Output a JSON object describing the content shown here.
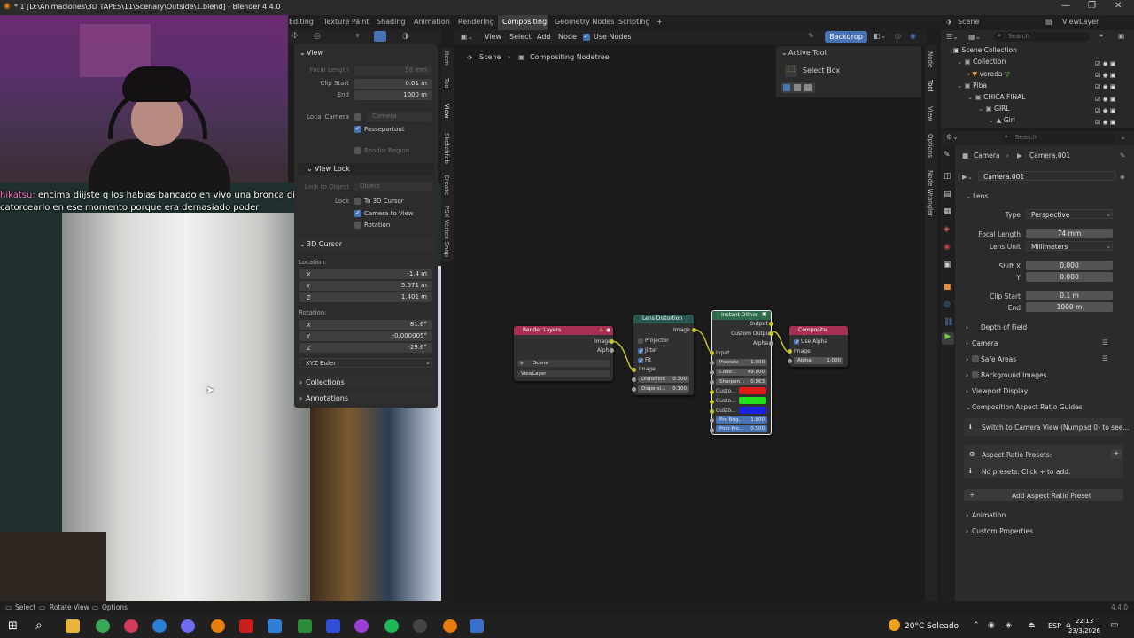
{
  "window": {
    "title": "* 1 [D:\\Animaciones\\3D TAPES\\11\\Scenary\\Outside\\1.blend] - Blender 4.4.0"
  },
  "workspaces": [
    "Editing",
    "Texture Paint",
    "Shading",
    "Animation",
    "Rendering",
    "Compositing",
    "Geometry Nodes",
    "Scripting",
    "+"
  ],
  "topbar_right": {
    "scene": "Scene",
    "view_layer": "ViewLayer"
  },
  "chat": {
    "user": "hikatsu:",
    "message": " encima diijste q los habias bancado en vivo una bronca dios me hizo catorcearlo en ese momento porque era demasiado poder"
  },
  "viewport_tabs": [
    "Item",
    "Tool",
    "View",
    "Sketchfab",
    "Create",
    "PSX Vertex Snap"
  ],
  "npanel": {
    "view_header": "View",
    "focal_length_label": "Focal Length",
    "focal_length": "50 mm",
    "clip_start_label": "Clip Start",
    "clip_start": "0.01 m",
    "end_label": "End",
    "end": "1000 m",
    "local_camera_label": "Local Camera",
    "local_camera_value": "Camera",
    "passepartout": "Passepartout",
    "render_region": "Render Region",
    "view_lock_header": "View Lock",
    "lock_to_object_label": "Lock to Object",
    "lock_to_object_value": "Object",
    "lock_label": "Lock",
    "to_3d_cursor": "To 3D Cursor",
    "camera_to_view": "Camera to View",
    "rotation": "Rotation",
    "cursor_header": "3D Cursor",
    "location_label": "Location:",
    "loc_x_label": "X",
    "loc_x": "-1.4 m",
    "loc_y_label": "Y",
    "loc_y": "5.571 m",
    "loc_z_label": "Z",
    "loc_z": "1.401 m",
    "rotation_label": "Rotation:",
    "rot_x_label": "X",
    "rot_x": "81.6°",
    "rot_y_label": "Y",
    "rot_y": "-0.000005°",
    "rot_z_label": "Z",
    "rot_z": "-29.6°",
    "euler": "XYZ Euler",
    "collections": "Collections",
    "annotations": "Annotations"
  },
  "node_editor": {
    "menu": [
      "View",
      "Select",
      "Add",
      "Node"
    ],
    "use_nodes": "Use Nodes",
    "backdrop": "Backdrop",
    "breadcrumb_scene": "Scene",
    "breadcrumb_tree": "Compositing Nodetree",
    "active_tool_header": "Active Tool",
    "select_box": "Select Box",
    "sidebar_tabs": [
      "Node",
      "Tool",
      "View",
      "Options",
      "Node Wrangler"
    ]
  },
  "nodes": {
    "render_layers": {
      "title": "Render Layers",
      "out_image": "Image",
      "out_alpha": "Alpha",
      "scene": "Scene",
      "view_layer": "ViewLayer"
    },
    "lens_distortion": {
      "title": "Lens Distortion",
      "out_image": "Image",
      "projector": "Projector",
      "jitter": "Jitter",
      "fit": "Fit",
      "in_image": "Image",
      "distortion_label": "Distortion",
      "distortion": "0.300",
      "dispersion_label": "Dispersi...",
      "dispersion": "0.100"
    },
    "instant_dither": {
      "title": "Instant Dither",
      "out_output": "Output",
      "out_custom": "Custom Output",
      "out_alpha": "Alpha",
      "input": "Input",
      "pixelate_label": "Pixelate",
      "pixelate": "1.000",
      "color_label": "Color...",
      "color": "49.800",
      "sharpen_label": "Sharpen...",
      "sharpen": "0.063",
      "custo1": "Custo...",
      "custo2": "Custo...",
      "custo3": "Custo...",
      "pre_bright_label": "Pre Brig...",
      "pre_bright": "1.000",
      "post_label": "Post Pro...",
      "post": "0.500",
      "colors": {
        "c1": "#e01919",
        "c2": "#22e01a",
        "c3": "#1a24e0"
      }
    },
    "composite": {
      "title": "Composite",
      "use_alpha": "Use Alpha",
      "image": "Image",
      "alpha_label": "Alpha",
      "alpha": "1.000"
    }
  },
  "outliner": {
    "search_placeholder": "Search",
    "items": [
      "Scene Collection",
      "Collection",
      "vereda",
      "Piba",
      "CHICA FINAL",
      "GIRL",
      "Girl"
    ]
  },
  "properties": {
    "search_placeholder": "Search",
    "breadcrumb_obj": "Camera",
    "breadcrumb_data": "Camera.001",
    "datablock": "Camera.001",
    "lens_header": "Lens",
    "type_label": "Type",
    "type": "Perspective",
    "focal_label": "Focal Length",
    "focal": "74 mm",
    "unit_label": "Lens Unit",
    "unit": "Millimeters",
    "shift_x_label": "Shift X",
    "shift_x": "0.000",
    "shift_y_label": "Y",
    "shift_y": "0.000",
    "clip_start_label": "Clip Start",
    "clip_start": "0.1 m",
    "clip_end_label": "End",
    "clip_end": "1000 m",
    "sections": [
      "Depth of Field",
      "Camera",
      "Safe Areas",
      "Background Images",
      "Viewport Display",
      "Composition Aspect Ratio Guides"
    ],
    "guide_button": "Switch to Camera View (Numpad 0) to see...",
    "presets_label": "Aspect Ratio Presets:",
    "no_presets": "No presets. Click + to add.",
    "add_preset": "Add Aspect Ratio Preset",
    "animation": "Animation",
    "custom_properties": "Custom Properties"
  },
  "statusbar": {
    "select": "Select",
    "rotate_view": "Rotate View",
    "options": "Options",
    "version": "4.4.0"
  },
  "taskbar": {
    "weather": "20°C Soleado",
    "lang": "ESP",
    "time": "22:13",
    "date": "23/3/2026"
  }
}
